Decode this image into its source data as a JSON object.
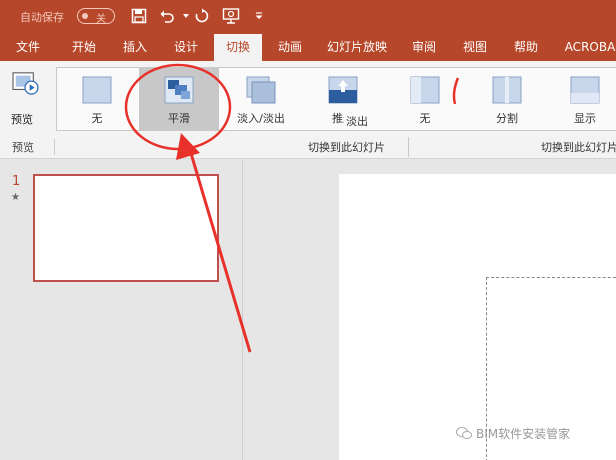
{
  "titlebar": {
    "autosave_label": "自动保存",
    "autosave_state": "关",
    "icons": [
      "save-icon",
      "undo-icon",
      "redo-icon",
      "present-from-start-icon",
      "customize-qat-icon"
    ]
  },
  "tabs": [
    {
      "label": "文件"
    },
    {
      "label": "开始"
    },
    {
      "label": "插入"
    },
    {
      "label": "设计"
    },
    {
      "label": "切换",
      "active": true
    },
    {
      "label": "动画"
    },
    {
      "label": "幻灯片放映"
    },
    {
      "label": "审阅"
    },
    {
      "label": "视图"
    },
    {
      "label": "帮助"
    },
    {
      "label": "ACROBA"
    }
  ],
  "ribbon": {
    "preview_label": "预览",
    "preview_group_label": "预览",
    "transitions": [
      {
        "label": "无"
      },
      {
        "label": "平滑",
        "selected": true
      },
      {
        "label": "淡入/淡出"
      },
      {
        "label": "推进"
      },
      {
        "label": "无"
      },
      {
        "label": "分割"
      },
      {
        "label": "显示"
      }
    ],
    "push_tooltip": "淡出",
    "group_label_1": "切换到此幻灯片",
    "group_label_2": "切换到此幻灯片"
  },
  "thumbnails": {
    "slide_number": "1",
    "star": "★"
  },
  "watermark": {
    "text": "BIM软件安装管家"
  },
  "colors": {
    "accent": "#b7472a",
    "annotation_red": "#e8312a"
  }
}
